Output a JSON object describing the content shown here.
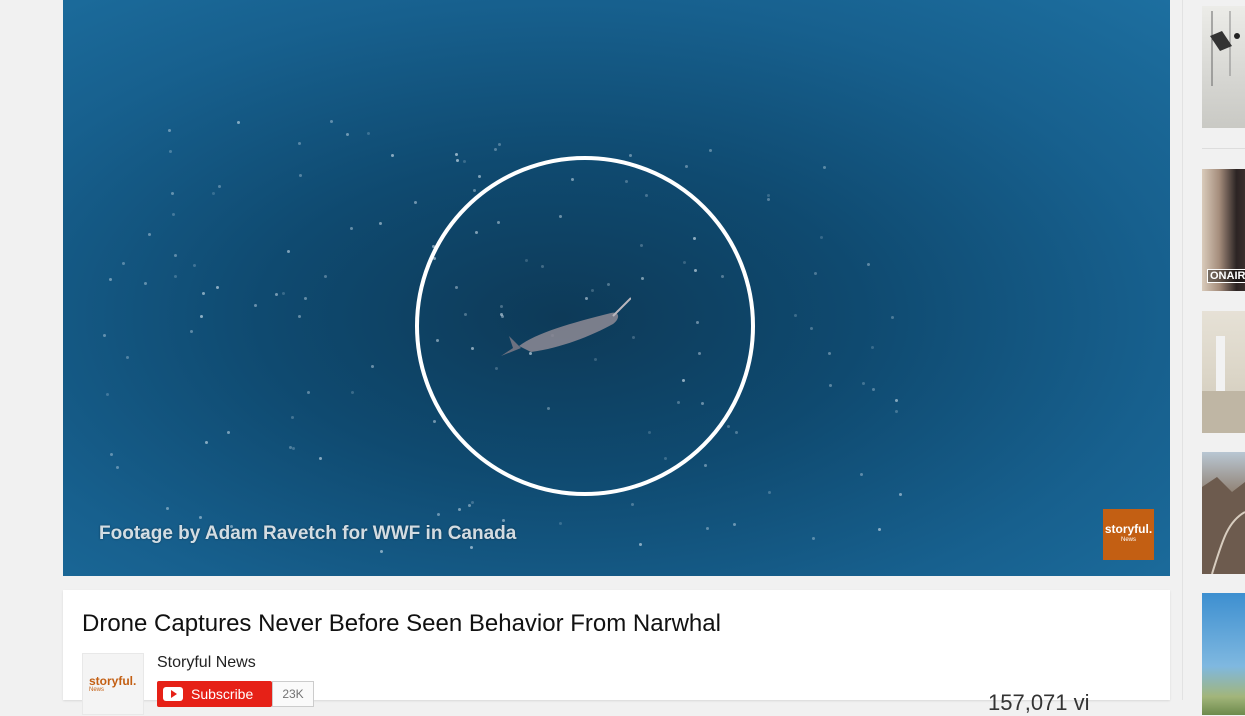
{
  "video": {
    "overlay_caption": "Footage by Adam Ravetch for WWF in Canada",
    "watermark_text": "storyful.",
    "watermark_sub": "News"
  },
  "info": {
    "title": "Drone Captures Never Before Seen Behavior From Narwhal",
    "channel_name": "Storyful News",
    "avatar_logo": "storyful.",
    "avatar_logo_sub": "News",
    "subscribe_label": "Subscribe",
    "subscriber_count": "23K",
    "views_partial": "157,071 vi"
  },
  "sidebar": {
    "thumbs": [
      {
        "label": ""
      },
      {
        "label": "ONAIR"
      },
      {
        "label": ""
      },
      {
        "label": ""
      },
      {
        "label": ""
      }
    ]
  },
  "colors": {
    "subscribe_red": "#e62117",
    "brand_orange": "#c35f13"
  }
}
